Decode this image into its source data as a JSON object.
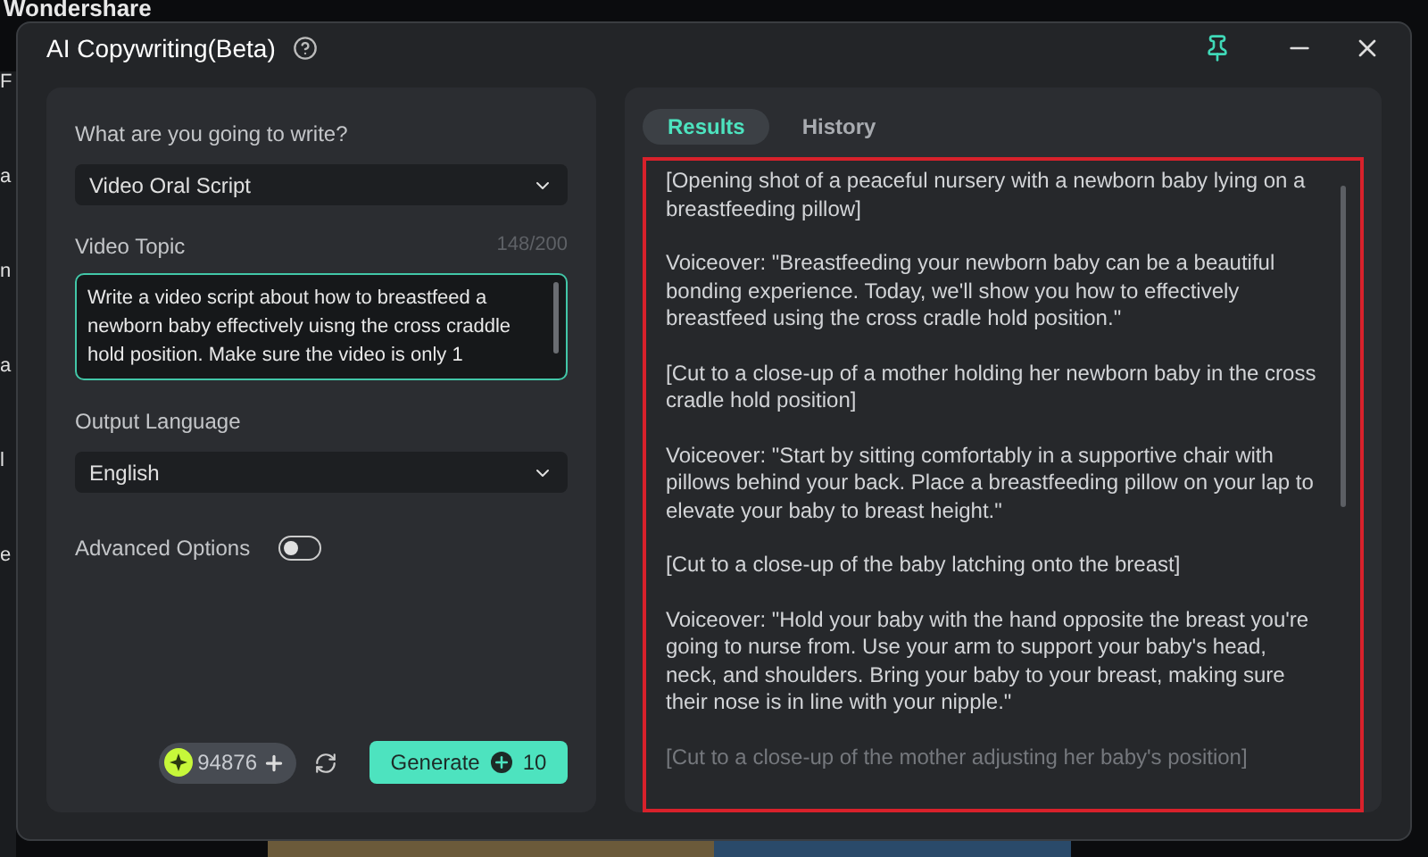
{
  "background": {
    "app_title": "Wondershare",
    "side_fragments": [
      "F",
      "a",
      "n",
      "a",
      "l",
      "e"
    ]
  },
  "window": {
    "title": "AI Copywriting(Beta)",
    "pinned": true
  },
  "form": {
    "type_label": "What are you going to write?",
    "type_value": "Video Oral Script",
    "topic_label": "Video Topic",
    "topic_count": "148/200",
    "topic_value": "Write a video script about how to breastfeed a newborn baby effectively uisng the cross craddle hold position. Make sure the video is only 1",
    "language_label": "Output Language",
    "language_value": "English",
    "advanced_label": "Advanced Options",
    "advanced_on": false,
    "credits": "94876",
    "generate_label": "Generate",
    "generate_cost": "10"
  },
  "tabs": [
    {
      "label": "Results",
      "selected": true
    },
    {
      "label": "History",
      "selected": false
    }
  ],
  "results": [
    {
      "text": "[Opening shot of a peaceful nursery with a newborn baby lying on a breastfeeding pillow]",
      "faded": false
    },
    {
      "text": "Voiceover: \"Breastfeeding your newborn baby can be a beautiful bonding experience. Today, we'll show you how to effectively breastfeed using the cross cradle hold position.\"",
      "faded": false
    },
    {
      "text": "[Cut to a close-up of a mother holding her newborn baby in the cross cradle hold position]",
      "faded": false
    },
    {
      "text": "Voiceover: \"Start by sitting comfortably in a supportive chair with pillows behind your back. Place a breastfeeding pillow on your lap to elevate your baby to breast height.\"",
      "faded": false
    },
    {
      "text": "[Cut to a close-up of the baby latching onto the breast]",
      "faded": false
    },
    {
      "text": "Voiceover: \"Hold your baby with the hand opposite the breast you're going to nurse from. Use your arm to support your baby's head, neck, and shoulders. Bring your baby to your breast, making sure their nose is in line with your nipple.\"",
      "faded": false
    },
    {
      "text": "[Cut to a close-up of the mother adjusting her baby's position]",
      "faded": true
    }
  ]
}
